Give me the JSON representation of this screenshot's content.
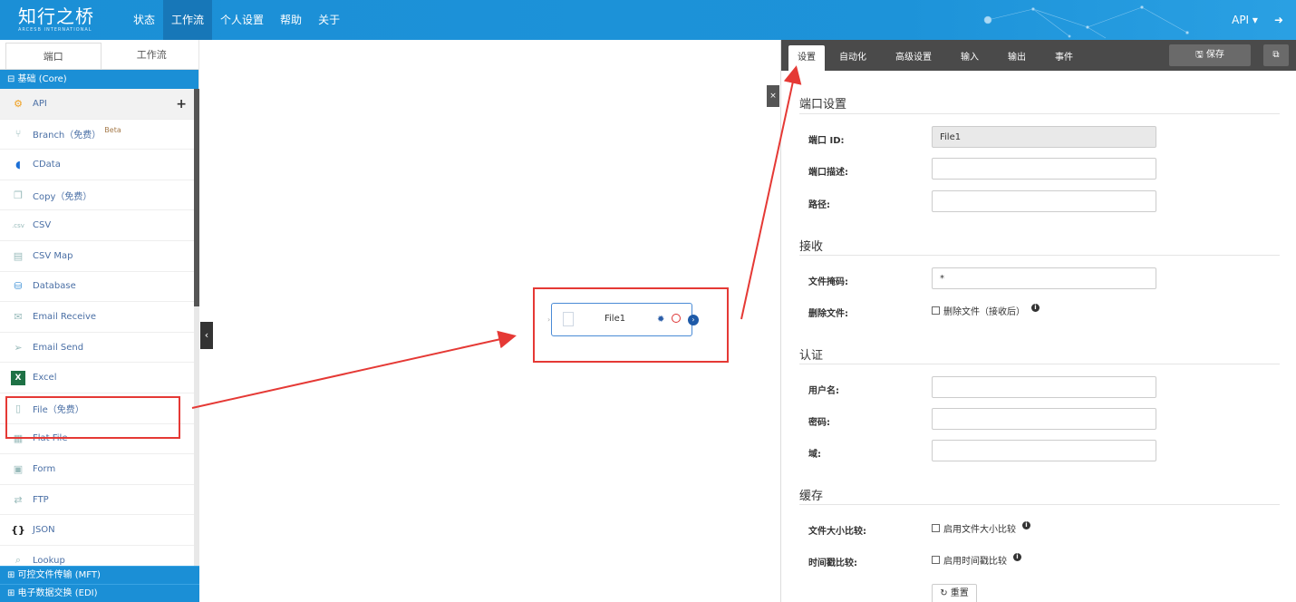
{
  "topbar": {
    "logo_main": "知行之桥",
    "logo_sub": "ARCESB INTERNATIONAL",
    "nav": [
      "状态",
      "工作流",
      "个人设置",
      "帮助",
      "关于"
    ],
    "active_nav": "工作流",
    "user_menu": "API ▾",
    "logout_icon": "logout-icon"
  },
  "left": {
    "tabs": [
      "端口",
      "工作流"
    ],
    "active_tab": "端口",
    "core_group": "⊟ 基础 (Core)",
    "connectors": [
      {
        "label": "API",
        "icon": "api-icon"
      },
      {
        "label": "Branch（免费）",
        "icon": "branch-icon",
        "badge": "Beta"
      },
      {
        "label": "CData",
        "icon": "cdata-icon"
      },
      {
        "label": "Copy（免费）",
        "icon": "copy-icon"
      },
      {
        "label": "CSV",
        "icon": "csv-icon"
      },
      {
        "label": "CSV Map",
        "icon": "csv-map-icon"
      },
      {
        "label": "Database",
        "icon": "database-icon"
      },
      {
        "label": "Email Receive",
        "icon": "email-receive-icon"
      },
      {
        "label": "Email Send",
        "icon": "email-send-icon"
      },
      {
        "label": "Excel",
        "icon": "excel-icon"
      },
      {
        "label": "File（免费）",
        "icon": "file-icon"
      },
      {
        "label": "Flat File",
        "icon": "flat-file-icon"
      },
      {
        "label": "Form",
        "icon": "form-icon"
      },
      {
        "label": "FTP",
        "icon": "ftp-icon"
      },
      {
        "label": "JSON",
        "icon": "json-icon"
      },
      {
        "label": "Lookup",
        "icon": "lookup-icon"
      }
    ],
    "add_symbol": "+",
    "mft_group": "⊞ 可控文件传输 (MFT)",
    "edi_group": "⊞ 电子数据交换 (EDI)"
  },
  "canvas": {
    "node_label": "File1",
    "collapse_symbol": "‹",
    "close_symbol": "×"
  },
  "right": {
    "tabs": [
      "设置",
      "自动化",
      "高级设置",
      "输入",
      "输出",
      "事件"
    ],
    "active_tab": "设置",
    "save_label": "🖫 保存",
    "popout_symbol": "⧉",
    "sections": {
      "port": "端口设置",
      "receive": "接收",
      "auth": "认证",
      "cache": "缓存"
    },
    "fields": {
      "port_id_label": "端口 ID:",
      "port_id_value": "File1",
      "port_desc_label": "端口描述:",
      "path_label": "路径:",
      "file_mask_label": "文件掩码:",
      "file_mask_value": "*",
      "delete_label": "删除文件:",
      "delete_check": "删除文件（接收后）",
      "username_label": "用户名:",
      "password_label": "密码:",
      "domain_label": "域:",
      "size_compare_label": "文件大小比较:",
      "size_compare_check": "启用文件大小比较",
      "time_compare_label": "时间戳比较:",
      "time_compare_check": "启用时间戳比较",
      "reset_label": "↻ 重置"
    }
  },
  "colors": {
    "brand": "#1b8fd6",
    "annotation": "#e53935"
  }
}
